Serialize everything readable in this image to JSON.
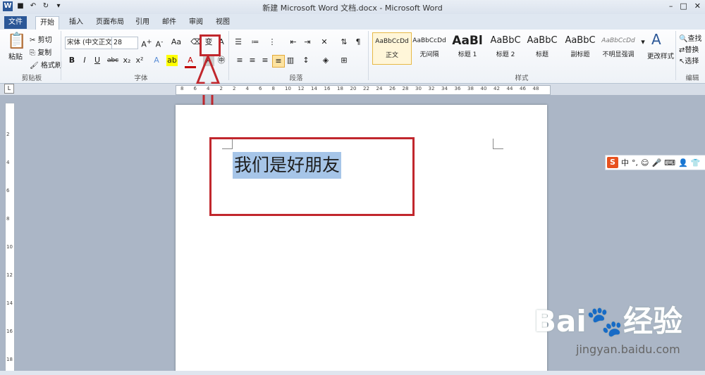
{
  "window": {
    "title": "新建 Microsoft Word 文档.docx - Microsoft Word"
  },
  "tabs": [
    "文件",
    "开始",
    "插入",
    "页面布局",
    "引用",
    "邮件",
    "审阅",
    "视图"
  ],
  "clipboard": {
    "paste": "粘贴",
    "cut": "剪切",
    "copy": "复制",
    "format_painter": "格式刷",
    "label": "剪贴板"
  },
  "font": {
    "name": "宋体 (中文正文)",
    "size": "28",
    "label": "字体"
  },
  "paragraph": {
    "label": "段落"
  },
  "styles": {
    "label": "样式",
    "items": [
      {
        "preview": "AaBbCcDd",
        "name": "正文"
      },
      {
        "preview": "AaBbCcDd",
        "name": "无间隔"
      },
      {
        "preview": "AaBl",
        "name": "标题 1"
      },
      {
        "preview": "AaBbC",
        "name": "标题 2"
      },
      {
        "preview": "AaBbC",
        "name": "标题"
      },
      {
        "preview": "AaBbC",
        "name": "副标题"
      },
      {
        "preview": "AaBbCcDd",
        "name": "不明显强调"
      }
    ],
    "change_styles": "更改样式"
  },
  "editing": {
    "find": "查找",
    "replace": "替换",
    "select": "选择",
    "label": "编辑"
  },
  "document": {
    "text": "我们是好朋友"
  },
  "ruler": {
    "h": [
      "8",
      "6",
      "4",
      "2",
      "2",
      "4",
      "6",
      "8",
      "10",
      "12",
      "14",
      "16",
      "18",
      "20",
      "22",
      "24",
      "26",
      "28",
      "30",
      "32",
      "34",
      "36",
      "38",
      "40",
      "42",
      "44",
      "46",
      "48"
    ]
  },
  "watermark": {
    "brand": "Bai",
    "brand2": "经验",
    "url": "jingyan.baidu.com"
  },
  "ime": {
    "lang": "中"
  },
  "colors": {
    "accent": "#2b5797",
    "highlight": "#c1272d",
    "selection": "#a6c5e8"
  }
}
